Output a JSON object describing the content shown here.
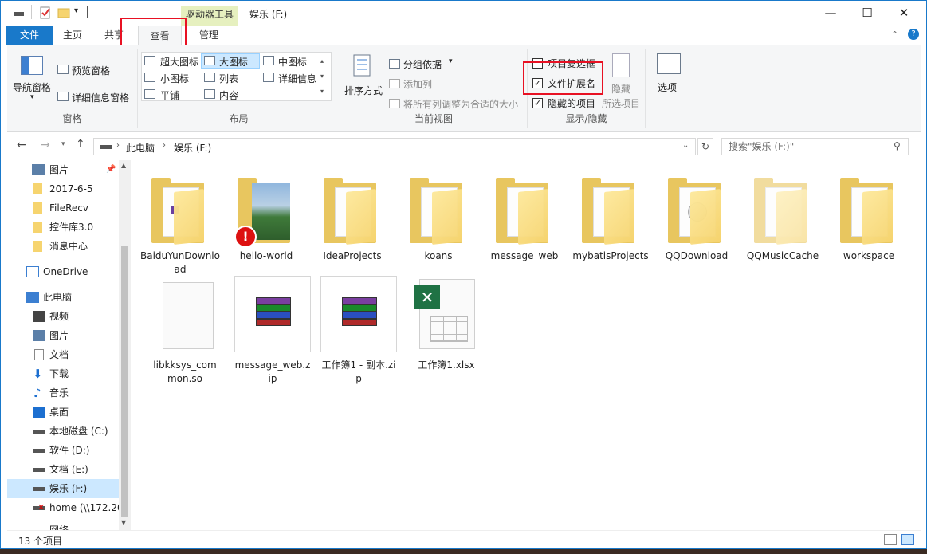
{
  "window": {
    "title": "娱乐 (F:)",
    "drive_tools": "驱动器工具",
    "controls": {
      "minimize": "—",
      "maximize": "☐",
      "close": "✕"
    },
    "colors": {
      "accent": "#1979ca",
      "highlight_box": "#e81123",
      "drive_tools_bg": "#e6f0bf",
      "folder": "#f6d46f"
    }
  },
  "tabs": [
    "文件",
    "主页",
    "共享",
    "查看",
    "管理"
  ],
  "ribbon": {
    "pane_group": {
      "label": "窗格",
      "nav_pane": "导航窗格",
      "preview_pane": "预览窗格",
      "details_pane": "详细信息窗格"
    },
    "layout_group": {
      "label": "布局",
      "options": [
        "超大图标",
        "大图标",
        "中图标",
        "小图标",
        "列表",
        "详细信息",
        "平铺",
        "内容"
      ]
    },
    "current_view_group": {
      "label": "当前视图",
      "sort_by": "排序方式",
      "group_by": "分组依据",
      "add_columns": "添加列",
      "size_all": "将所有列调整为合适的大小"
    },
    "show_hide_group": {
      "label": "显示/隐藏",
      "item_checkboxes": {
        "label": "项目复选框",
        "checked": false
      },
      "file_extensions": {
        "label": "文件扩展名",
        "checked": true
      },
      "hidden_items": {
        "label": "隐藏的项目",
        "checked": true
      },
      "hide_selected": "隐藏",
      "hide_selected2": "所选项目"
    },
    "options": "选项"
  },
  "address": {
    "path": [
      "此电脑",
      "娱乐 (F:)"
    ],
    "search_placeholder": "搜索\"娱乐 (F:)\""
  },
  "nav": {
    "quick": [
      "图片",
      "2017-6-5",
      "FileRecv",
      "控件库3.0",
      "消息中心"
    ],
    "onedrive": "OneDrive",
    "this_pc": "此电脑",
    "pc_items": [
      "视频",
      "图片",
      "文档",
      "下载",
      "音乐",
      "桌面",
      "本地磁盘 (C:)",
      "软件 (D:)",
      "文档 (E:)",
      "娱乐 (F:)",
      "home (\\\\172.20"
    ],
    "cut_item": "网络"
  },
  "items": [
    {
      "name": "BaiduYunDownload",
      "kind": "folder"
    },
    {
      "name": "hello-world",
      "kind": "folder-photo"
    },
    {
      "name": "IdeaProjects",
      "kind": "folder"
    },
    {
      "name": "koans",
      "kind": "folder"
    },
    {
      "name": "message_web",
      "kind": "folder"
    },
    {
      "name": "mybatisProjects",
      "kind": "folder"
    },
    {
      "name": "QQDownload",
      "kind": "folder"
    },
    {
      "name": "QQMusicCache",
      "kind": "folder"
    },
    {
      "name": "workspace",
      "kind": "folder"
    },
    {
      "name": "libkksys_common.so",
      "kind": "file"
    },
    {
      "name": "message_web.zip",
      "kind": "archive"
    },
    {
      "name": "工作簿1 - 副本.zip",
      "kind": "archive"
    },
    {
      "name": "工作簿1.xlsx",
      "kind": "excel"
    }
  ],
  "status": {
    "count": "13 个项目"
  }
}
